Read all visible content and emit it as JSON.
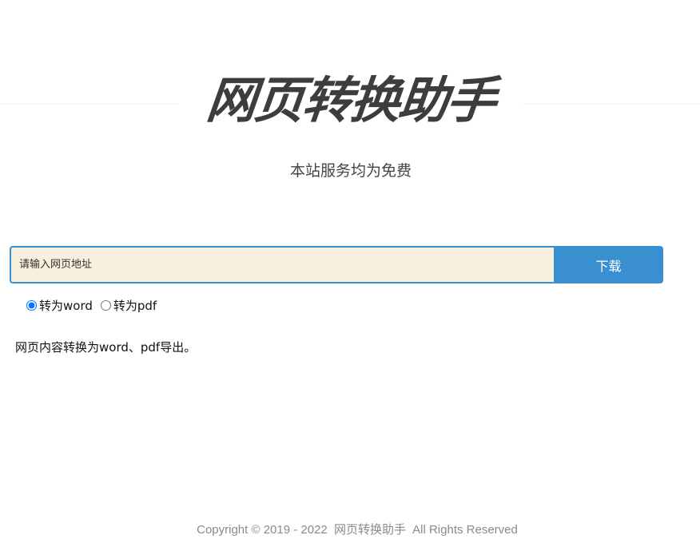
{
  "header": {
    "title": "网页转换助手",
    "subtitle": "本站服务均为免费"
  },
  "search": {
    "placeholder": "请输入网页地址",
    "value": "",
    "button_label": "下载"
  },
  "options": [
    {
      "label": "转为word",
      "checked": true
    },
    {
      "label": "转为pdf",
      "checked": false
    }
  ],
  "description": "网页内容转换为word、pdf导出。",
  "footer": {
    "copyright": "Copyright © 2019 - 2022",
    "site_name": "网页转换助手",
    "rights": "All Rights Reserved"
  },
  "colors": {
    "accent": "#3a8fd0",
    "input_background": "#f8efdc",
    "title": "#3d3d3d"
  }
}
